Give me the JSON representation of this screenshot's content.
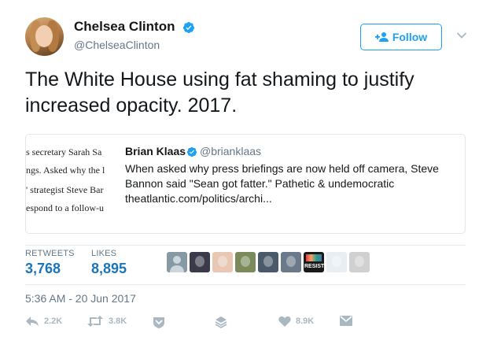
{
  "user": {
    "name": "Chelsea Clinton",
    "handle": "@ChelseaClinton",
    "follow_label": "Follow"
  },
  "tweet": {
    "text": "The White House using fat shaming to justify increased opacity. 2017.",
    "timestamp": "5:36 AM - 20 Jun 2017"
  },
  "quoted": {
    "thumb_lines": [
      "s secretary Sarah Sa",
      "ngs. Asked why the l",
      "' strategist Steve Bar",
      "espond to a follow-u"
    ],
    "author": "Brian Klaas",
    "handle": "@brianklaas",
    "text": "When asked why press briefings are now held off camera, Steve Bannon said \"Sean got fatter.\" Pathetic & undemocratic theatlantic.com/politics/archi..."
  },
  "stats": {
    "retweets_label": "RETWEETS",
    "retweets_value": "3,768",
    "likes_label": "LIKES",
    "likes_value": "8,895",
    "liker_avatars": [
      {
        "icon": "avatar-default",
        "color": "#8899a6"
      },
      {
        "icon": "avatar-photo",
        "color": "#3a3a4a"
      },
      {
        "icon": "avatar-photo",
        "color": "#e8c7b5"
      },
      {
        "icon": "avatar-photo",
        "color": "#7a8a5a"
      },
      {
        "icon": "avatar-photo",
        "color": "#4a5a6a"
      },
      {
        "icon": "avatar-photo",
        "color": "#6a7a8a"
      },
      {
        "icon": "avatar-resist",
        "color": "#1a1a1a",
        "text": "RESIST"
      },
      {
        "icon": "avatar-graphic",
        "color": "#e8eef2"
      },
      {
        "icon": "avatar-photo",
        "color": "#d0d0d0"
      }
    ]
  },
  "actions": {
    "reply_count": "2.2K",
    "retweet_count": "3.8K",
    "like_count": "8.9K"
  },
  "colors": {
    "accent": "#1da1f2",
    "stat_value": "#1b75bb",
    "muted": "#657786",
    "action_icon": "#aab8c2"
  }
}
